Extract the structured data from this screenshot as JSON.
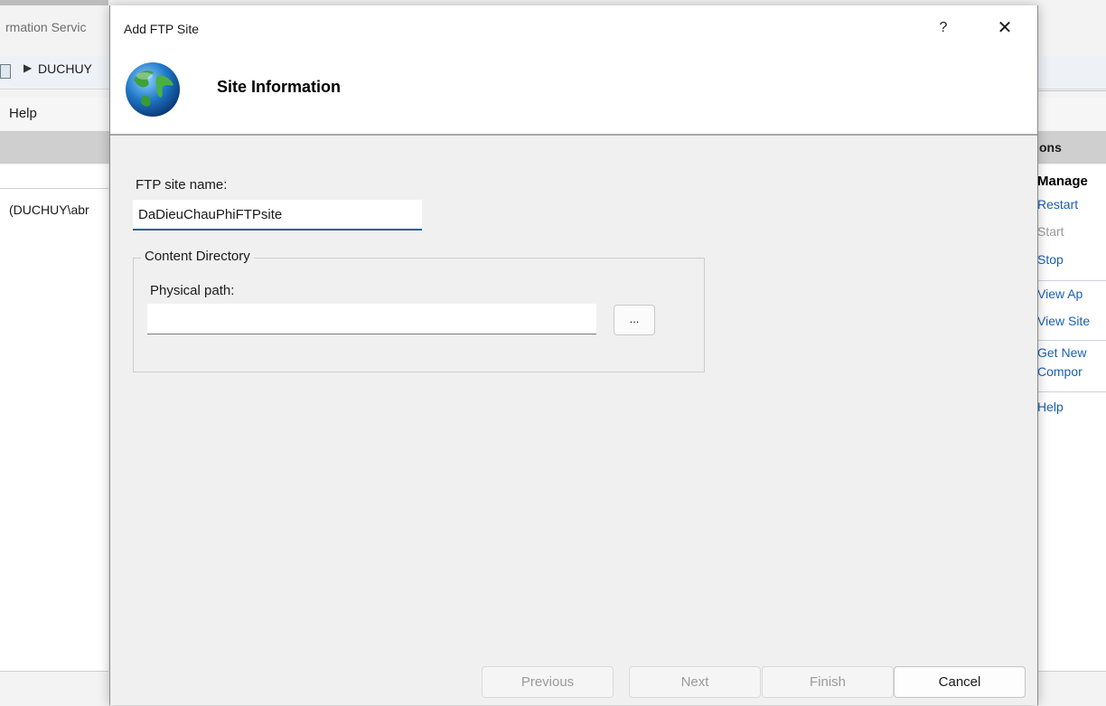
{
  "background_window": {
    "title_fragment": "rmation Servic",
    "address_fragment": "DUCHUY",
    "menu_help": "Help",
    "left_list_item": "(DUCHUY\\abr",
    "actions_header": "ons",
    "actions": {
      "manage_header": "Manage",
      "restart": "Restart",
      "start": "Start",
      "stop": "Stop",
      "view_app": "View Ap",
      "view_sites": "View Site",
      "get_new_1": "Get New",
      "get_new_2": "Compor",
      "help": "Help"
    }
  },
  "dialog": {
    "title": "Add FTP Site",
    "help_glyph": "?",
    "close_glyph": "✕",
    "page_title": "Site Information",
    "site_name_label": "FTP site name:",
    "site_name_value": "DaDieuChauPhiFTPsite",
    "content_directory_legend": "Content Directory",
    "physical_path_label": "Physical path:",
    "physical_path_value": "",
    "browse_label": "...",
    "buttons": {
      "previous": "Previous",
      "next": "Next",
      "finish": "Finish",
      "cancel": "Cancel"
    }
  }
}
